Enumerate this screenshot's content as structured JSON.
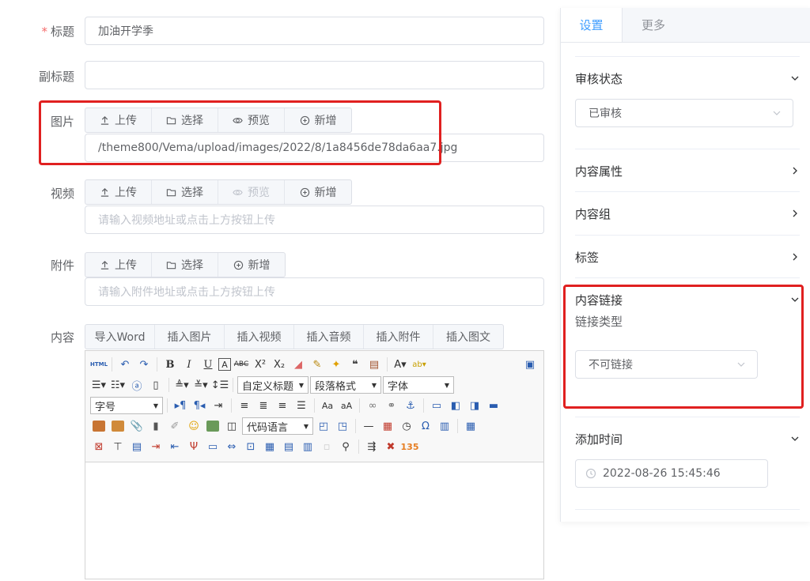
{
  "form": {
    "title_label": "标题",
    "required_mark": "*",
    "title_value": "加油开学季",
    "subtitle_label": "副标题",
    "subtitle_value": "",
    "image_label": "图片",
    "image_path": "/theme800/Vema/upload/images/2022/8/1a8456de78da6aa7.jpg",
    "video_label": "视频",
    "video_placeholder": "请输入视频地址或点击上方按钮上传",
    "attachment_label": "附件",
    "attachment_placeholder": "请输入附件地址或点击上方按钮上传",
    "content_label": "内容"
  },
  "buttons": {
    "upload": "上传",
    "choose": "选择",
    "preview": "预览",
    "add": "新增"
  },
  "content_tabs": [
    "导入Word",
    "插入图片",
    "插入视频",
    "插入音频",
    "插入附件",
    "插入图文"
  ],
  "editor": {
    "custom_title": "自定义标题",
    "paragraph_format": "段落格式",
    "font": "字体",
    "font_size": "字号",
    "code_language": "代码语言"
  },
  "panel": {
    "tab_settings": "设置",
    "tab_more": "更多",
    "review_status_label": "审核状态",
    "review_status_value": "已审核",
    "content_attr_label": "内容属性",
    "content_group_label": "内容组",
    "tags_label": "标签",
    "content_link_label": "内容链接",
    "link_type_label": "链接类型",
    "link_type_value": "不可链接",
    "add_time_label": "添加时间",
    "add_time_value": "2022-08-26 15:45:46"
  },
  "colors": {
    "accent": "#409eff",
    "highlight_box": "#e02020",
    "required": "#f56c6c"
  }
}
